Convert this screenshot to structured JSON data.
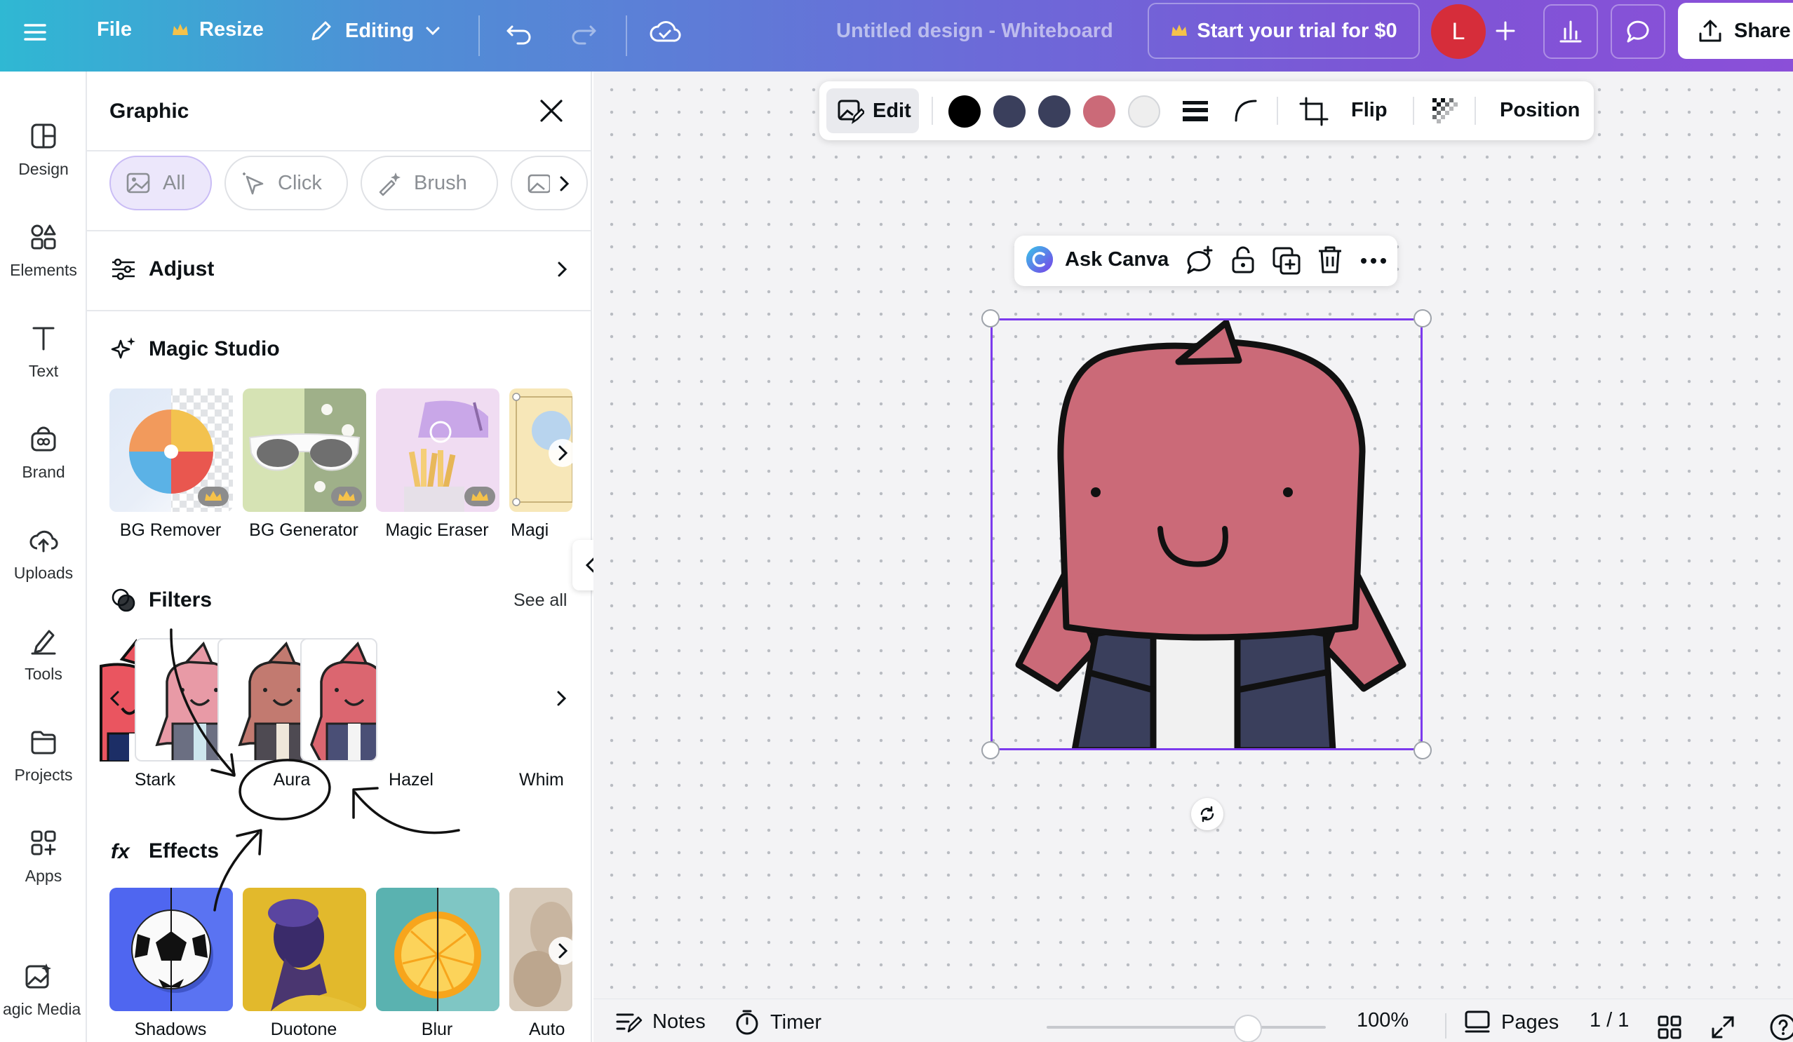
{
  "topbar": {
    "file_label": "File",
    "resize_label": "Resize",
    "editing_label": "Editing",
    "doc_title": "Untitled design - Whiteboard",
    "trial_label": "Start your trial for $0",
    "avatar_initial": "L",
    "share_label": "Share"
  },
  "rail": {
    "items": [
      {
        "label": "Design",
        "icon": "design-icon"
      },
      {
        "label": "Elements",
        "icon": "elements-icon"
      },
      {
        "label": "Text",
        "icon": "text-icon"
      },
      {
        "label": "Brand",
        "icon": "brand-icon"
      },
      {
        "label": "Uploads",
        "icon": "uploads-icon"
      },
      {
        "label": "Tools",
        "icon": "tools-icon"
      },
      {
        "label": "Projects",
        "icon": "projects-icon"
      },
      {
        "label": "Apps",
        "icon": "apps-icon"
      },
      {
        "label": "agic Media",
        "icon": "magic-media-icon"
      }
    ]
  },
  "panel": {
    "title": "Graphic",
    "chips": [
      "All",
      "Click",
      "Brush"
    ],
    "adjust_label": "Adjust",
    "magic_studio_label": "Magic Studio",
    "magic_tools": [
      "BG Remover",
      "BG Generator",
      "Magic Eraser",
      "Magi"
    ],
    "filters_label": "Filters",
    "see_all_label": "See all",
    "filters": [
      "Stark",
      "Aura",
      "Hazel",
      "Whim"
    ],
    "effects_label": "Effects",
    "effects": [
      "Shadows",
      "Duotone",
      "Blur",
      "Auto"
    ]
  },
  "context_toolbar": {
    "edit_label": "Edit",
    "flip_label": "Flip",
    "position_label": "Position",
    "swatches": [
      "#000000",
      "#3a3f5c",
      "#3a3f5c",
      "#cb6a78",
      "#eeeeee"
    ]
  },
  "float_toolbar": {
    "ask_label": "Ask Canva"
  },
  "bottombar": {
    "notes_label": "Notes",
    "timer_label": "Timer",
    "zoom_label": "100%",
    "zoom_level": 0.72,
    "pages_label": "Pages",
    "page_count": "1 / 1"
  },
  "colors": {
    "accent": "#7c3aed",
    "character_body": "#cb6a78",
    "character_jacket": "#3a3f5c"
  }
}
